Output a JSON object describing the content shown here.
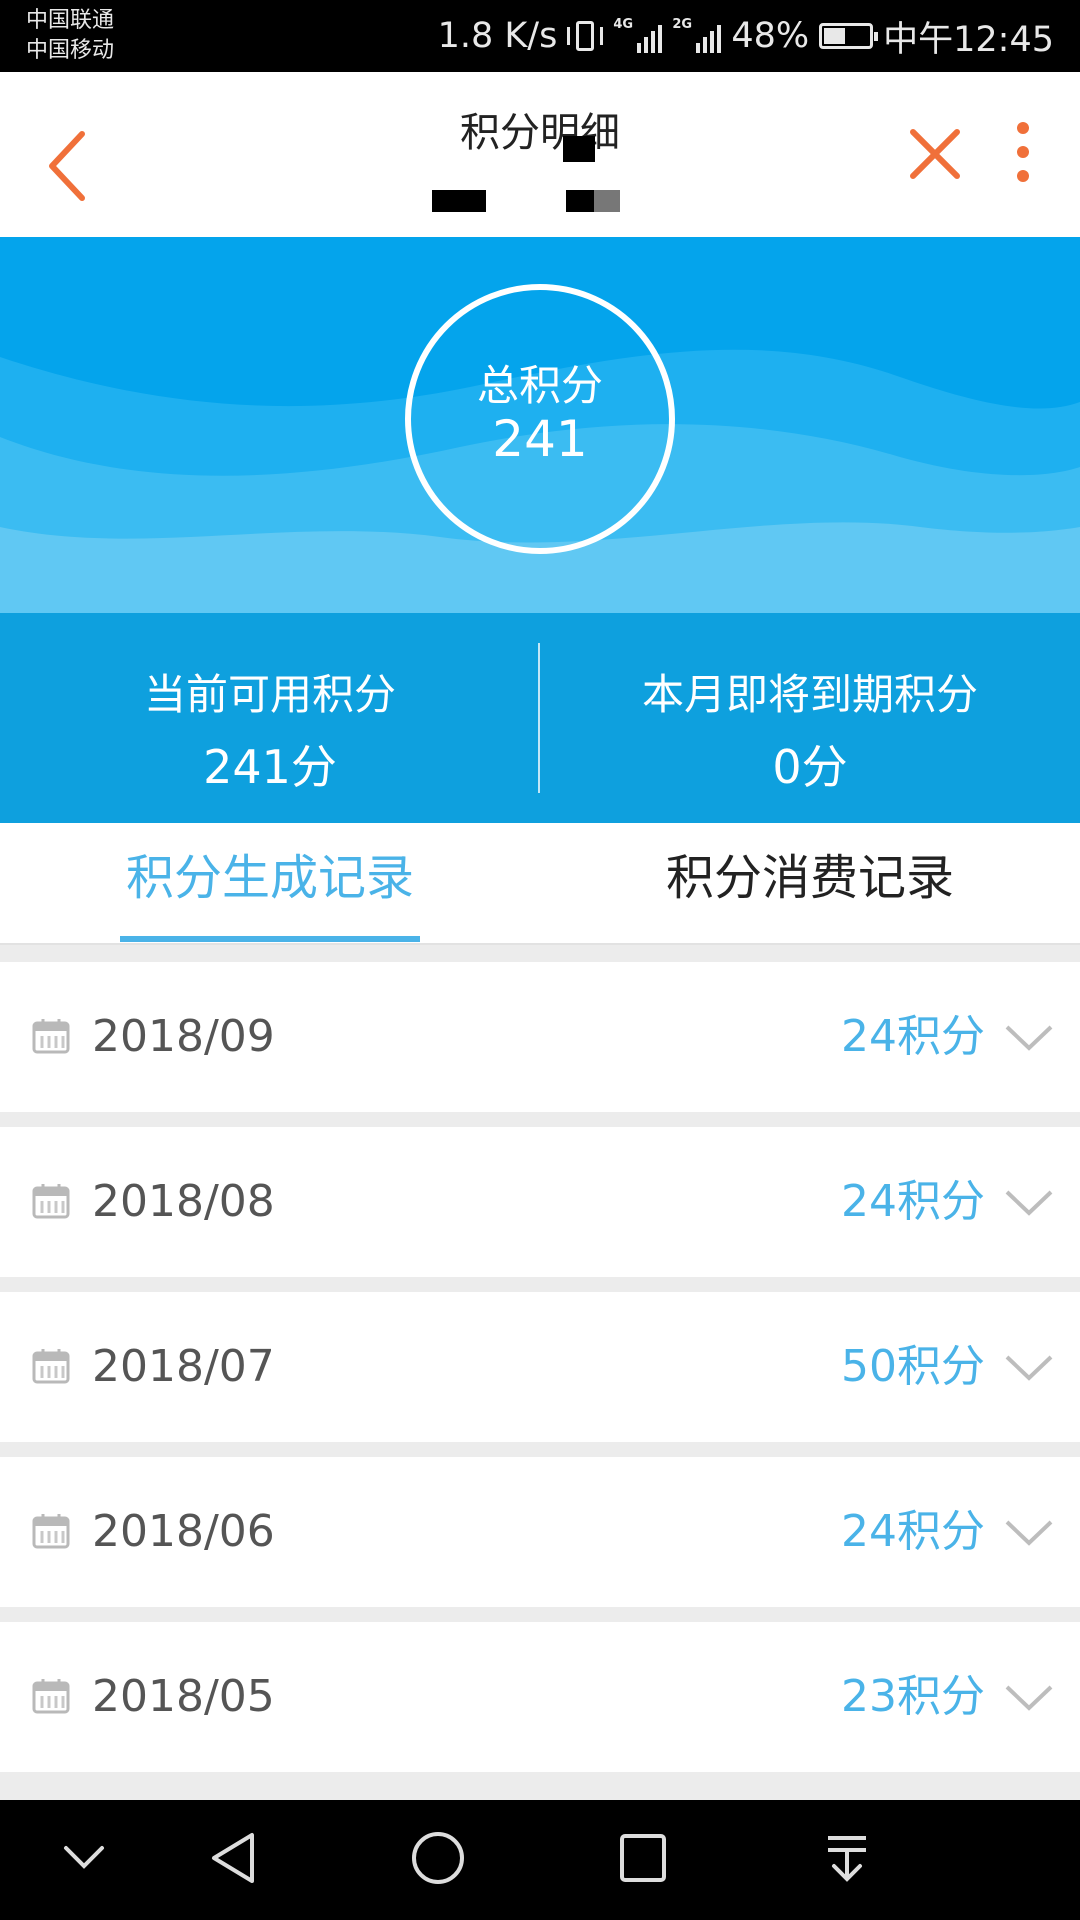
{
  "status_bar": {
    "carrier1": "中国联通",
    "carrier2": "中国移动",
    "speed": "1.8 K/s",
    "net1": "4G",
    "net2": "2G",
    "battery": "48%",
    "battery_level": 0.48,
    "time": "中午12:45"
  },
  "header": {
    "title": "积分明细"
  },
  "hero": {
    "total_label": "总积分",
    "total_value": "241"
  },
  "summary": {
    "available_label": "当前可用积分",
    "available_value": "241分",
    "expiring_label": "本月即将到期积分",
    "expiring_value": "0分"
  },
  "tabs": [
    {
      "label": "积分生成记录",
      "active": true
    },
    {
      "label": "积分消费记录",
      "active": false
    }
  ],
  "records": [
    {
      "date": "2018/09",
      "points": "24积分"
    },
    {
      "date": "2018/08",
      "points": "24积分"
    },
    {
      "date": "2018/07",
      "points": "50积分"
    },
    {
      "date": "2018/06",
      "points": "24积分"
    },
    {
      "date": "2018/05",
      "points": "23积分"
    }
  ],
  "colors": {
    "accent": "#4ab3e8",
    "hero_bg": "#04a4ec",
    "summary_bg": "#0ea0de",
    "header_icons": "#f0703a"
  },
  "icons": {
    "back": "chevron-left-icon",
    "close": "close-icon",
    "more": "more-vertical-icon",
    "calendar": "calendar-icon",
    "expand": "chevron-down-icon"
  }
}
